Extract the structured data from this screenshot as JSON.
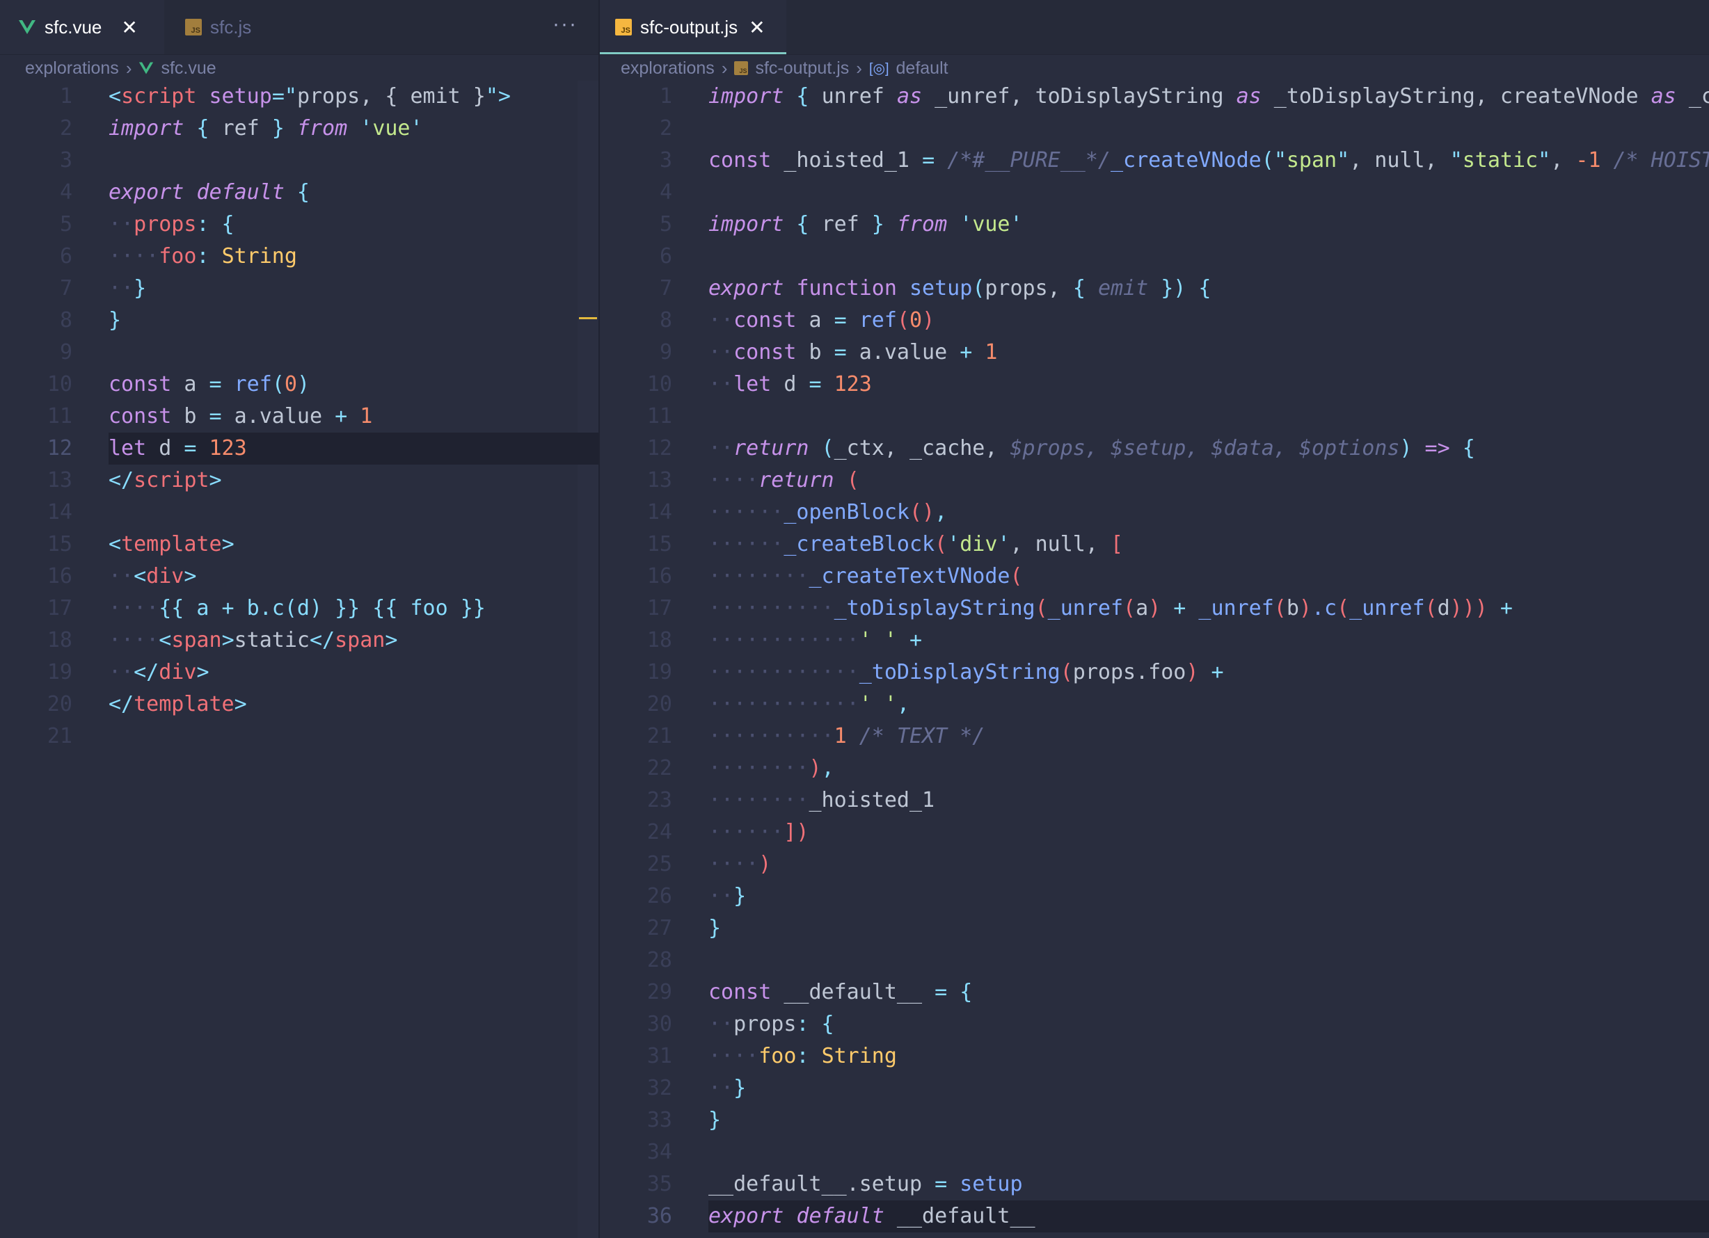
{
  "left": {
    "tabs": [
      {
        "label": "sfc.vue",
        "icon": "vue-icon",
        "active": true
      },
      {
        "label": "sfc.js",
        "icon": "js-icon",
        "active": false
      }
    ],
    "more_label": "···",
    "breadcrumb": [
      "explorations",
      "sfc.vue"
    ],
    "lines": [
      [
        [
          "<",
          "p"
        ],
        [
          "script",
          "t"
        ],
        [
          " ",
          "w"
        ],
        [
          "setup",
          "k"
        ],
        [
          "=\"",
          "p"
        ],
        [
          "props, { emit }",
          "w"
        ],
        [
          "\">",
          "p"
        ]
      ],
      [
        [
          "import",
          "ki"
        ],
        [
          " { ",
          "p"
        ],
        [
          "ref",
          "w"
        ],
        [
          " } ",
          "p"
        ],
        [
          "from",
          "ki"
        ],
        [
          " ",
          "w"
        ],
        [
          "'",
          "p"
        ],
        [
          "vue",
          "s"
        ],
        [
          "'",
          "p"
        ]
      ],
      [],
      [
        [
          "export",
          "ki"
        ],
        [
          " ",
          "w"
        ],
        [
          "default",
          "ki"
        ],
        [
          " {",
          "p"
        ]
      ],
      [
        [
          "··",
          "ws"
        ],
        [
          "props",
          "t"
        ],
        [
          ": {",
          "p"
        ]
      ],
      [
        [
          "····",
          "ws"
        ],
        [
          "foo",
          "t"
        ],
        [
          ": ",
          "p"
        ],
        [
          "String",
          "y"
        ]
      ],
      [
        [
          "··",
          "ws"
        ],
        [
          "}",
          "p"
        ]
      ],
      [
        [
          "}",
          "p"
        ]
      ],
      [],
      [
        [
          "const",
          "k"
        ],
        [
          " a ",
          "w"
        ],
        [
          "=",
          "p"
        ],
        [
          " ",
          "w"
        ],
        [
          "ref",
          "f"
        ],
        [
          "(",
          "p"
        ],
        [
          "0",
          "n"
        ],
        [
          ")",
          "p"
        ]
      ],
      [
        [
          "const",
          "k"
        ],
        [
          " b ",
          "w"
        ],
        [
          "=",
          "p"
        ],
        [
          " a.value ",
          "w"
        ],
        [
          "+",
          "p"
        ],
        [
          " ",
          "w"
        ],
        [
          "1",
          "n"
        ]
      ],
      [
        [
          "let",
          "k"
        ],
        [
          " d ",
          "w"
        ],
        [
          "=",
          "p"
        ],
        [
          " ",
          "w"
        ],
        [
          "123",
          "n"
        ]
      ],
      [
        [
          "</",
          "p"
        ],
        [
          "script",
          "t"
        ],
        [
          ">",
          "p"
        ]
      ],
      [],
      [
        [
          "<",
          "p"
        ],
        [
          "template",
          "t"
        ],
        [
          ">",
          "p"
        ]
      ],
      [
        [
          "··",
          "ws"
        ],
        [
          "<",
          "p"
        ],
        [
          "div",
          "t"
        ],
        [
          ">",
          "p"
        ]
      ],
      [
        [
          "····",
          "ws"
        ],
        [
          "{{ a + b.c(d) }} {{ foo }}",
          "p"
        ]
      ],
      [
        [
          "····",
          "ws"
        ],
        [
          "<",
          "p"
        ],
        [
          "span",
          "t"
        ],
        [
          ">",
          "p"
        ],
        [
          "static",
          "w"
        ],
        [
          "</",
          "p"
        ],
        [
          "span",
          "t"
        ],
        [
          ">",
          "p"
        ]
      ],
      [
        [
          "··",
          "ws"
        ],
        [
          "</",
          "p"
        ],
        [
          "div",
          "t"
        ],
        [
          ">",
          "p"
        ]
      ],
      [
        [
          "</",
          "p"
        ],
        [
          "template",
          "t"
        ],
        [
          ">",
          "p"
        ]
      ],
      []
    ],
    "current_line": 12
  },
  "right": {
    "tabs": [
      {
        "label": "sfc-output.js",
        "icon": "js-icon",
        "active": true,
        "close": "✕"
      }
    ],
    "breadcrumb": [
      "explorations",
      "sfc-output.js",
      "default"
    ],
    "lines": [
      [
        [
          "import",
          "ki"
        ],
        [
          " { ",
          "p"
        ],
        [
          "unref ",
          "w"
        ],
        [
          "as",
          "ki"
        ],
        [
          " _unref, toDisplayString ",
          "w"
        ],
        [
          "as",
          "ki"
        ],
        [
          " _toDisplayString, createVNode ",
          "w"
        ],
        [
          "as",
          "ki"
        ],
        [
          " _c",
          "w"
        ]
      ],
      [],
      [
        [
          "const",
          "k"
        ],
        [
          " _hoisted_1 ",
          "w"
        ],
        [
          "=",
          "p"
        ],
        [
          " ",
          "w"
        ],
        [
          "/*#__PURE__*/",
          "c"
        ],
        [
          "_createVNode",
          "f"
        ],
        [
          "(",
          "p"
        ],
        [
          "\"",
          "p"
        ],
        [
          "span",
          "s"
        ],
        [
          "\"",
          "p"
        ],
        [
          ", null, ",
          "w"
        ],
        [
          "\"",
          "p"
        ],
        [
          "static",
          "s"
        ],
        [
          "\"",
          "p"
        ],
        [
          ", ",
          "w"
        ],
        [
          "-1",
          "n"
        ],
        [
          " ",
          "w"
        ],
        [
          "/* HOIST",
          "c"
        ]
      ],
      [],
      [
        [
          "import",
          "ki"
        ],
        [
          " { ",
          "p"
        ],
        [
          "ref",
          "w"
        ],
        [
          " } ",
          "p"
        ],
        [
          "from",
          "ki"
        ],
        [
          " ",
          "w"
        ],
        [
          "'",
          "p"
        ],
        [
          "vue",
          "s"
        ],
        [
          "'",
          "p"
        ]
      ],
      [],
      [
        [
          "export",
          "ki"
        ],
        [
          " ",
          "w"
        ],
        [
          "function",
          "k"
        ],
        [
          " ",
          "w"
        ],
        [
          "setup",
          "f"
        ],
        [
          "(",
          "p"
        ],
        [
          "props, ",
          "w"
        ],
        [
          "{ ",
          "p"
        ],
        [
          "emit",
          "c"
        ],
        [
          " })",
          "p"
        ],
        [
          " {",
          "p"
        ]
      ],
      [
        [
          "··",
          "ws"
        ],
        [
          "const",
          "k"
        ],
        [
          " a ",
          "w"
        ],
        [
          "=",
          "p"
        ],
        [
          " ",
          "w"
        ],
        [
          "ref",
          "f"
        ],
        [
          "(",
          "t"
        ],
        [
          "0",
          "n"
        ],
        [
          ")",
          "t"
        ]
      ],
      [
        [
          "··",
          "ws"
        ],
        [
          "const",
          "k"
        ],
        [
          " b ",
          "w"
        ],
        [
          "=",
          "p"
        ],
        [
          " a.value ",
          "w"
        ],
        [
          "+",
          "p"
        ],
        [
          " ",
          "w"
        ],
        [
          "1",
          "n"
        ]
      ],
      [
        [
          "··",
          "ws"
        ],
        [
          "let",
          "k"
        ],
        [
          " d ",
          "w"
        ],
        [
          "=",
          "p"
        ],
        [
          " ",
          "w"
        ],
        [
          "123",
          "n"
        ]
      ],
      [],
      [
        [
          "··",
          "ws"
        ],
        [
          "return",
          "ki"
        ],
        [
          " (",
          "p"
        ],
        [
          "_ctx, _cache, ",
          "w"
        ],
        [
          "$props, $setup, $data, $options",
          "c"
        ],
        [
          ") ",
          "p"
        ],
        [
          "=>",
          "k"
        ],
        [
          " {",
          "p"
        ]
      ],
      [
        [
          "····",
          "ws"
        ],
        [
          "return",
          "ki"
        ],
        [
          " ",
          "w"
        ],
        [
          "(",
          "t"
        ]
      ],
      [
        [
          "······",
          "ws"
        ],
        [
          "_openBlock",
          "f"
        ],
        [
          "()",
          "t"
        ],
        [
          ",",
          "p"
        ]
      ],
      [
        [
          "······",
          "ws"
        ],
        [
          "_createBlock",
          "f"
        ],
        [
          "(",
          "t"
        ],
        [
          "'",
          "p"
        ],
        [
          "div",
          "s"
        ],
        [
          "'",
          "p"
        ],
        [
          ", null, ",
          "w"
        ],
        [
          "[",
          "t"
        ]
      ],
      [
        [
          "········",
          "ws"
        ],
        [
          "_createTextVNode",
          "f"
        ],
        [
          "(",
          "t"
        ]
      ],
      [
        [
          "··········",
          "ws"
        ],
        [
          "_toDisplayString",
          "f"
        ],
        [
          "(",
          "t"
        ],
        [
          "_unref",
          "f"
        ],
        [
          "(",
          "t"
        ],
        [
          "a",
          "w"
        ],
        [
          ")",
          "t"
        ],
        [
          " + ",
          "p"
        ],
        [
          "_unref",
          "f"
        ],
        [
          "(",
          "t"
        ],
        [
          "b",
          "w"
        ],
        [
          ")",
          "t"
        ],
        [
          ".c",
          "f"
        ],
        [
          "(",
          "t"
        ],
        [
          "_unref",
          "f"
        ],
        [
          "(",
          "t"
        ],
        [
          "d",
          "w"
        ],
        [
          ")))",
          "t"
        ],
        [
          " +",
          "p"
        ]
      ],
      [
        [
          "············",
          "ws"
        ],
        [
          "' '",
          "s"
        ],
        [
          " +",
          "p"
        ]
      ],
      [
        [
          "············",
          "ws"
        ],
        [
          "_toDisplayString",
          "f"
        ],
        [
          "(",
          "t"
        ],
        [
          "props.foo",
          "w"
        ],
        [
          ")",
          "t"
        ],
        [
          " +",
          "p"
        ]
      ],
      [
        [
          "············",
          "ws"
        ],
        [
          "' '",
          "s"
        ],
        [
          ",",
          "p"
        ]
      ],
      [
        [
          "··········",
          "ws"
        ],
        [
          "1",
          "n"
        ],
        [
          " ",
          "w"
        ],
        [
          "/* TEXT */",
          "c"
        ]
      ],
      [
        [
          "········",
          "ws"
        ],
        [
          ")",
          "t"
        ],
        [
          ",",
          "p"
        ]
      ],
      [
        [
          "········",
          "ws"
        ],
        [
          "_hoisted_1",
          "w"
        ]
      ],
      [
        [
          "······",
          "ws"
        ],
        [
          "])",
          "t"
        ]
      ],
      [
        [
          "····",
          "ws"
        ],
        [
          ")",
          "t"
        ]
      ],
      [
        [
          "··",
          "ws"
        ],
        [
          "}",
          "p"
        ]
      ],
      [
        [
          "}",
          "p"
        ]
      ],
      [],
      [
        [
          "const",
          "k"
        ],
        [
          " __default__ ",
          "w"
        ],
        [
          "=",
          "p"
        ],
        [
          " {",
          "p"
        ]
      ],
      [
        [
          "··",
          "ws"
        ],
        [
          "props",
          "w"
        ],
        [
          ": {",
          "p"
        ]
      ],
      [
        [
          "····",
          "ws"
        ],
        [
          "foo",
          "y"
        ],
        [
          ": ",
          "p"
        ],
        [
          "String",
          "y"
        ]
      ],
      [
        [
          "··",
          "ws"
        ],
        [
          "}",
          "p"
        ]
      ],
      [
        [
          "}",
          "p"
        ]
      ],
      [],
      [
        [
          "__default__.setup ",
          "w"
        ],
        [
          "=",
          "p"
        ],
        [
          " ",
          "w"
        ],
        [
          "setup",
          "f"
        ]
      ],
      [
        [
          "export",
          "ki"
        ],
        [
          " ",
          "w"
        ],
        [
          "default",
          "ki"
        ],
        [
          " __default__",
          "w"
        ]
      ]
    ],
    "current_line": 36
  },
  "colors": {
    "background": "#292d3e",
    "keyword": "#c792ea",
    "function": "#82aaff",
    "string": "#c3e88d",
    "number": "#f78c6c",
    "punctuation": "#89ddff",
    "comment": "#676e95",
    "tag": "#f07178",
    "type": "#ffcb6b",
    "tab_accent": "#80cbc4",
    "vue_green": "#41b883"
  }
}
